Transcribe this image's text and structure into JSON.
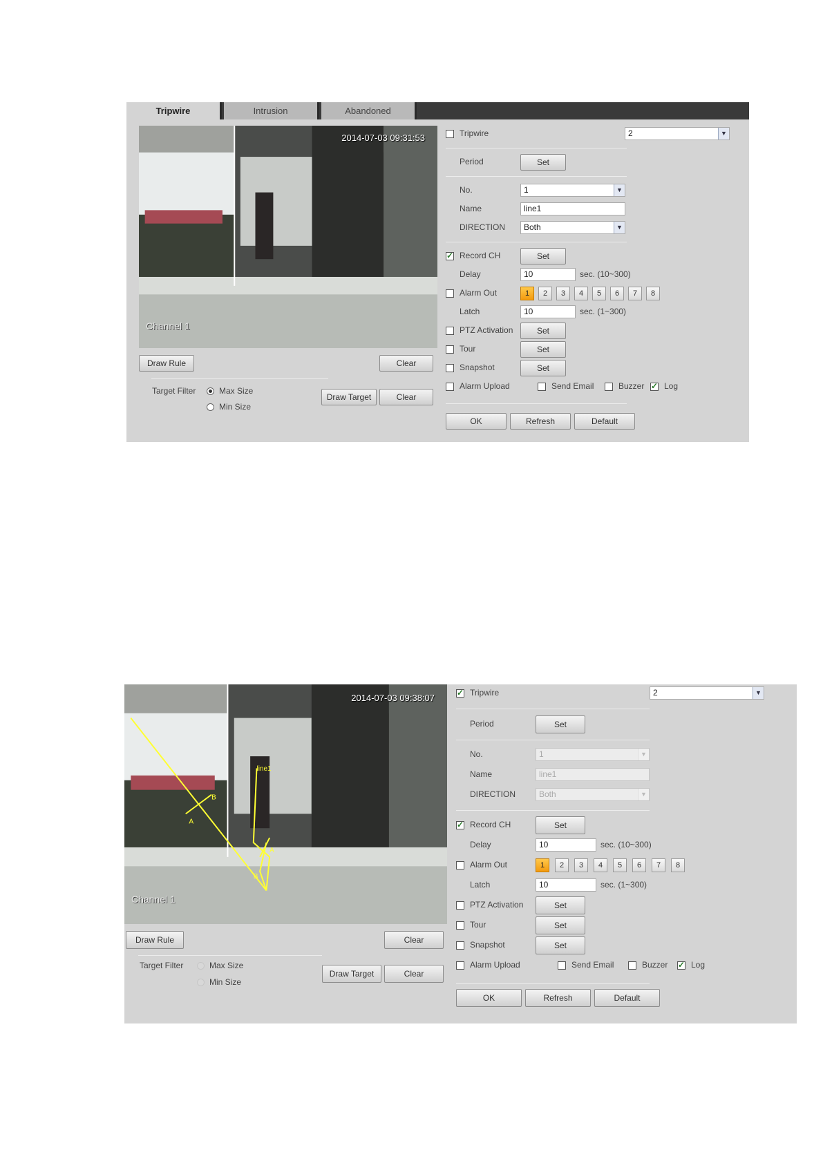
{
  "shot1": {
    "tabs": [
      "Tripwire",
      "Intrusion",
      "Abandoned"
    ],
    "timestamp": "2014-07-03 09:31:53",
    "channel": "Channel 1",
    "enable_label": "Tripwire",
    "enable_checked": false,
    "channel_select": "2",
    "period_label": "Period",
    "no_label": "No.",
    "no_value": "1",
    "name_label": "Name",
    "name_value": "line1",
    "direction_label": "DIRECTION",
    "direction_value": "Both",
    "fields_disabled": false,
    "record_label": "Record CH",
    "record_checked": true,
    "delay_label": "Delay",
    "delay_value": "10",
    "delay_hint": "sec. (10~300)",
    "alarm_out_label": "Alarm Out",
    "alarm_out_checked": false,
    "alarm_out_numbers": [
      "1",
      "2",
      "3",
      "4",
      "5",
      "6",
      "7",
      "8"
    ],
    "alarm_out_selected": "1",
    "latch_label": "Latch",
    "latch_value": "10",
    "latch_hint": "sec. (1~300)",
    "ptz_label": "PTZ Activation",
    "tour_label": "Tour",
    "snapshot_label": "Snapshot",
    "alarm_upload_label": "Alarm Upload",
    "send_email_label": "Send Email",
    "buzzer_label": "Buzzer",
    "log_label": "Log",
    "log_checked": true,
    "set_label": "Set",
    "draw_rule": "Draw Rule",
    "clear": "Clear",
    "target_filter": "Target Filter",
    "max_size": "Max Size",
    "min_size": "Min Size",
    "draw_target": "Draw Target",
    "ok": "OK",
    "refresh": "Refresh",
    "default": "Default",
    "drawn_rule": false
  },
  "shot2": {
    "timestamp": "2014-07-03 09:38:07",
    "channel": "Channel 1",
    "enable_label": "Tripwire",
    "enable_checked": true,
    "channel_select": "2",
    "period_label": "Period",
    "no_label": "No.",
    "no_value": "1",
    "name_label": "Name",
    "name_value": "line1",
    "direction_label": "DIRECTION",
    "direction_value": "Both",
    "fields_disabled": true,
    "record_label": "Record CH",
    "record_checked": true,
    "delay_label": "Delay",
    "delay_value": "10",
    "delay_hint": "sec. (10~300)",
    "alarm_out_label": "Alarm Out",
    "alarm_out_checked": false,
    "alarm_out_numbers": [
      "1",
      "2",
      "3",
      "4",
      "5",
      "6",
      "7",
      "8"
    ],
    "alarm_out_selected": "1",
    "latch_label": "Latch",
    "latch_value": "10",
    "latch_hint": "sec. (1~300)",
    "ptz_label": "PTZ Activation",
    "tour_label": "Tour",
    "snapshot_label": "Snapshot",
    "alarm_upload_label": "Alarm Upload",
    "send_email_label": "Send Email",
    "buzzer_label": "Buzzer",
    "log_label": "Log",
    "log_checked": true,
    "set_label": "Set",
    "draw_rule": "Draw Rule",
    "clear": "Clear",
    "target_filter": "Target Filter",
    "max_size": "Max Size",
    "min_size": "Min Size",
    "draw_target": "Draw Target",
    "ok": "OK",
    "refresh": "Refresh",
    "default": "Default",
    "drawn_rule": true,
    "rule_labels": [
      "line1",
      "A",
      "B",
      "A",
      "B"
    ],
    "rule_color": "#ffff33"
  },
  "colors": {
    "panel": "#d4d4d4",
    "tabbar": "#3a3a3a",
    "selected_alarm": "#f5a623"
  }
}
